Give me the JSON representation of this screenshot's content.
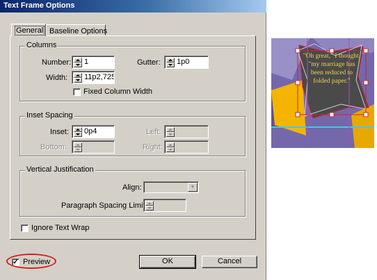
{
  "window": {
    "title": "Text Frame Options"
  },
  "tabs": [
    {
      "label": "General",
      "selected": true
    },
    {
      "label": "Baseline Options",
      "selected": false
    }
  ],
  "columns": {
    "title": "Columns",
    "number_label": "Number:",
    "number_value": "1",
    "gutter_label": "Gutter:",
    "gutter_value": "1p0",
    "width_label": "Width:",
    "width_value": "11p2,725",
    "fixed_width_label": "Fixed Column Width",
    "fixed_width_checked": false
  },
  "inset": {
    "title": "Inset Spacing",
    "inset_label": "Inset:",
    "inset_value": "0p4",
    "bottom_label": "Bottom:",
    "left_label": "Left:",
    "right_label": "Right:"
  },
  "vertical_justification": {
    "title": "Vertical Justification",
    "align_label": "Align:",
    "align_value": "",
    "paragraph_spacing_label": "Paragraph Spacing Limit:"
  },
  "ignore_text_wrap_label": "Ignore Text Wrap",
  "preview_label": "Preview",
  "preview_checked": true,
  "ok_label": "OK",
  "cancel_label": "Cancel",
  "artwork": {
    "frame_text": "\"Oh great,\" I thought, \"my marriage has been reduced to folded paper.\""
  },
  "colors": {
    "dialog_bg": "#d4d0c8",
    "title_bar": "#0a246a",
    "highlight_ring": "#d42020",
    "art_text": "#f0d24a"
  }
}
